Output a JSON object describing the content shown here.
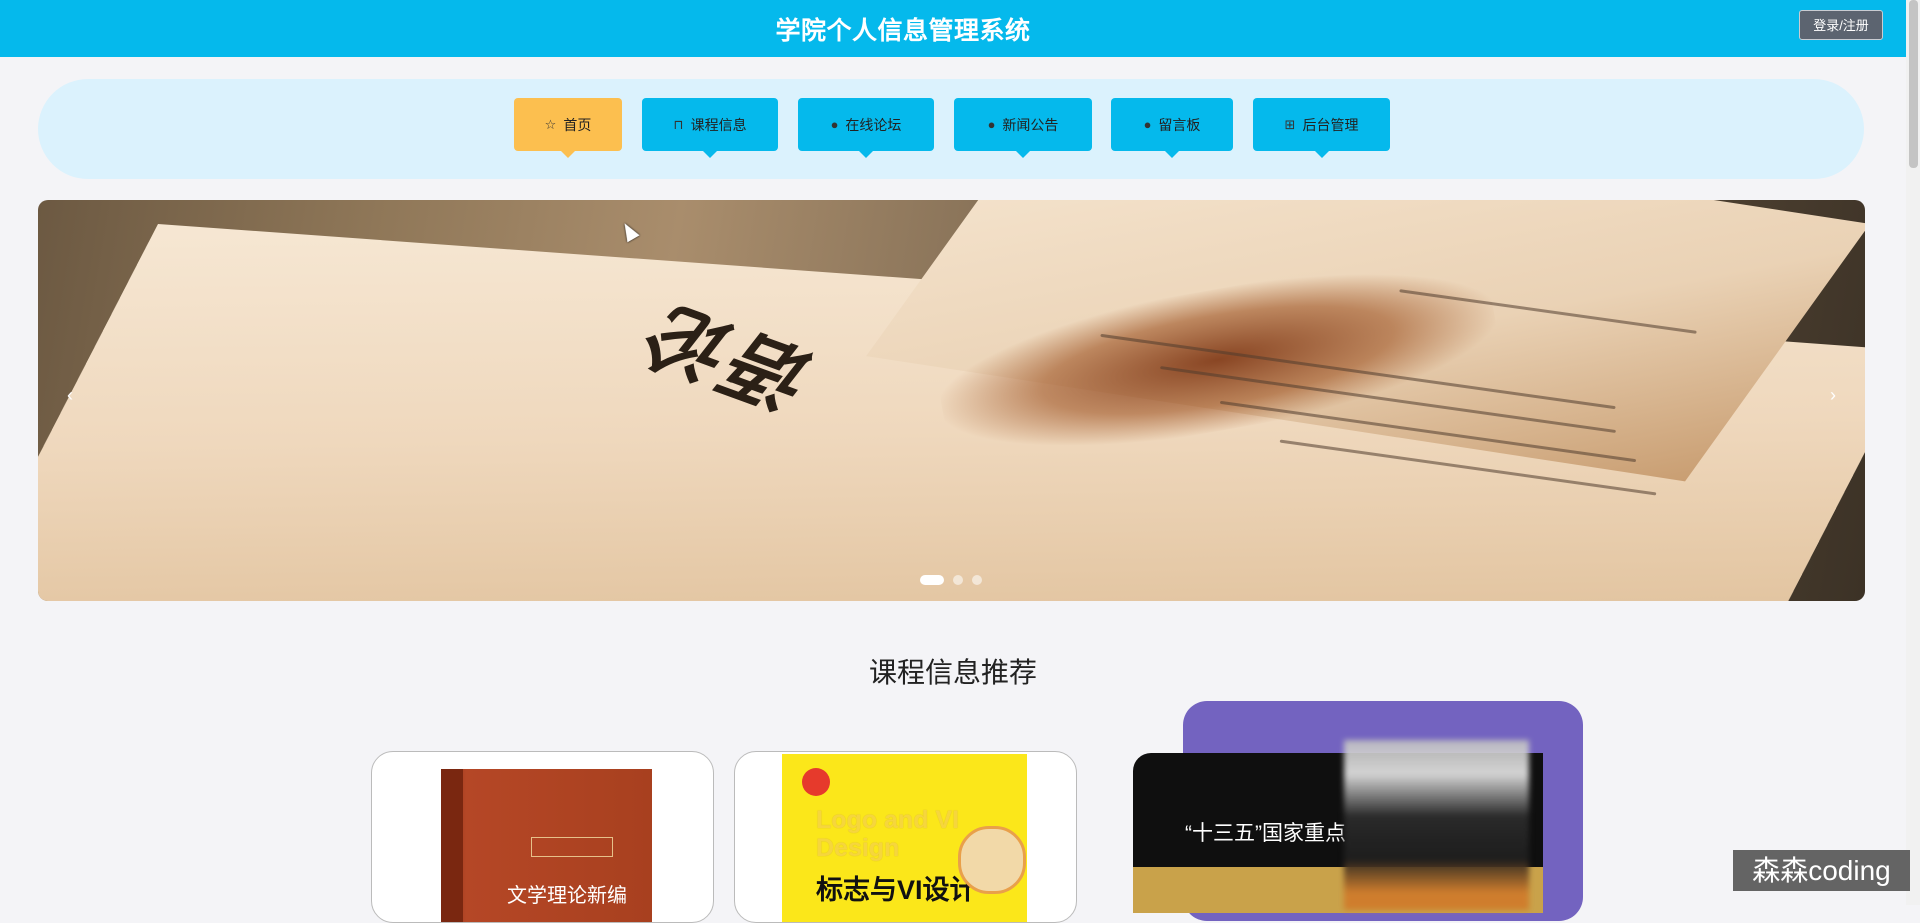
{
  "header": {
    "site_title": "学院个人信息管理系统",
    "login_label": "登录/注册"
  },
  "nav": {
    "items": [
      {
        "label": "首页",
        "icon": "star-icon",
        "active": true
      },
      {
        "label": "课程信息",
        "icon": "bag-icon",
        "active": false
      },
      {
        "label": "在线论坛",
        "icon": "info-circle-icon",
        "active": false
      },
      {
        "label": "新闻公告",
        "icon": "question-circle-icon",
        "active": false
      },
      {
        "label": "留言板",
        "icon": "info-circle-icon",
        "active": false
      },
      {
        "label": "后台管理",
        "icon": "briefcase-icon",
        "active": false
      }
    ]
  },
  "carousel": {
    "prev_label": "‹",
    "next_label": "›",
    "current_slide": 1,
    "slide_count": 3,
    "image_text": "语论"
  },
  "section": {
    "title": "课程信息推荐"
  },
  "cards": [
    {
      "cover_title": "文学理论新编"
    },
    {
      "cover_en": "Logo and VI Design",
      "cover_cn": "标志与VI设计"
    },
    {
      "cover_text": "“十三五”国家重点"
    }
  ],
  "watermark": "森森coding",
  "colors": {
    "primary": "#05b9ec",
    "active": "#fcbf4f",
    "nav_bg": "#dbf2fd",
    "card_accent": "#7363c0"
  }
}
